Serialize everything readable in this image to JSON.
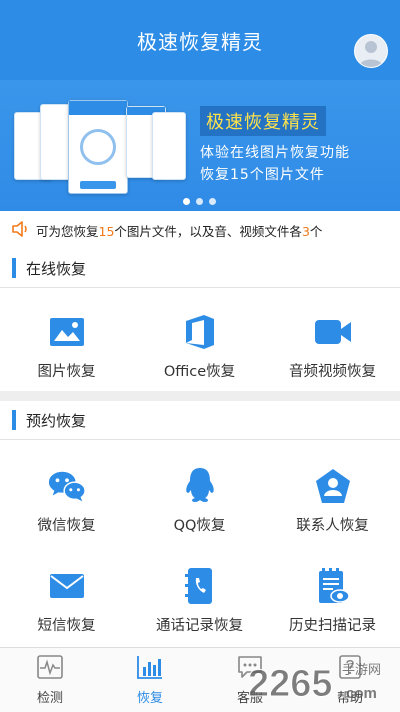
{
  "header": {
    "title": "极速恢复精灵",
    "avatar_icon": "user-avatar-icon"
  },
  "banner": {
    "title": "极速恢复精灵",
    "line1": "体验在线图片恢复功能",
    "line2": "恢复15个图片文件",
    "dots": 3,
    "active_dot": 1
  },
  "notice": {
    "icon": "speaker-icon",
    "part1": "可为您恢复",
    "count1": "15",
    "part2": "个图片文件，以及音、视频文件各",
    "count2": "3",
    "part3": "个"
  },
  "online": {
    "title": "在线恢复",
    "items": [
      {
        "label": "图片恢复",
        "icon": "image-icon"
      },
      {
        "label": "Office恢复",
        "icon": "office-icon"
      },
      {
        "label": "音频视频恢复",
        "icon": "video-camera-icon"
      }
    ]
  },
  "reserve": {
    "title": "预约恢复",
    "items": [
      {
        "label": "微信恢复",
        "icon": "wechat-icon"
      },
      {
        "label": "QQ恢复",
        "icon": "qq-icon"
      },
      {
        "label": "联系人恢复",
        "icon": "contact-icon"
      },
      {
        "label": "短信恢复",
        "icon": "envelope-icon"
      },
      {
        "label": "通话记录恢复",
        "icon": "call-log-icon"
      },
      {
        "label": "历史扫描记录",
        "icon": "scan-history-icon"
      }
    ]
  },
  "tabs": [
    {
      "label": "检测",
      "icon": "pulse-icon"
    },
    {
      "label": "恢复",
      "icon": "bar-chart-icon",
      "active": true
    },
    {
      "label": "客服",
      "icon": "chat-icon"
    },
    {
      "label": "帮助",
      "icon": "help-icon"
    }
  ],
  "watermark": {
    "number": "2265",
    "suffix": "com",
    "site": "手游网"
  },
  "colors": {
    "primary": "#2d8ce6",
    "highlight": "#f07a1b",
    "banner_title": "#ffe24b"
  }
}
